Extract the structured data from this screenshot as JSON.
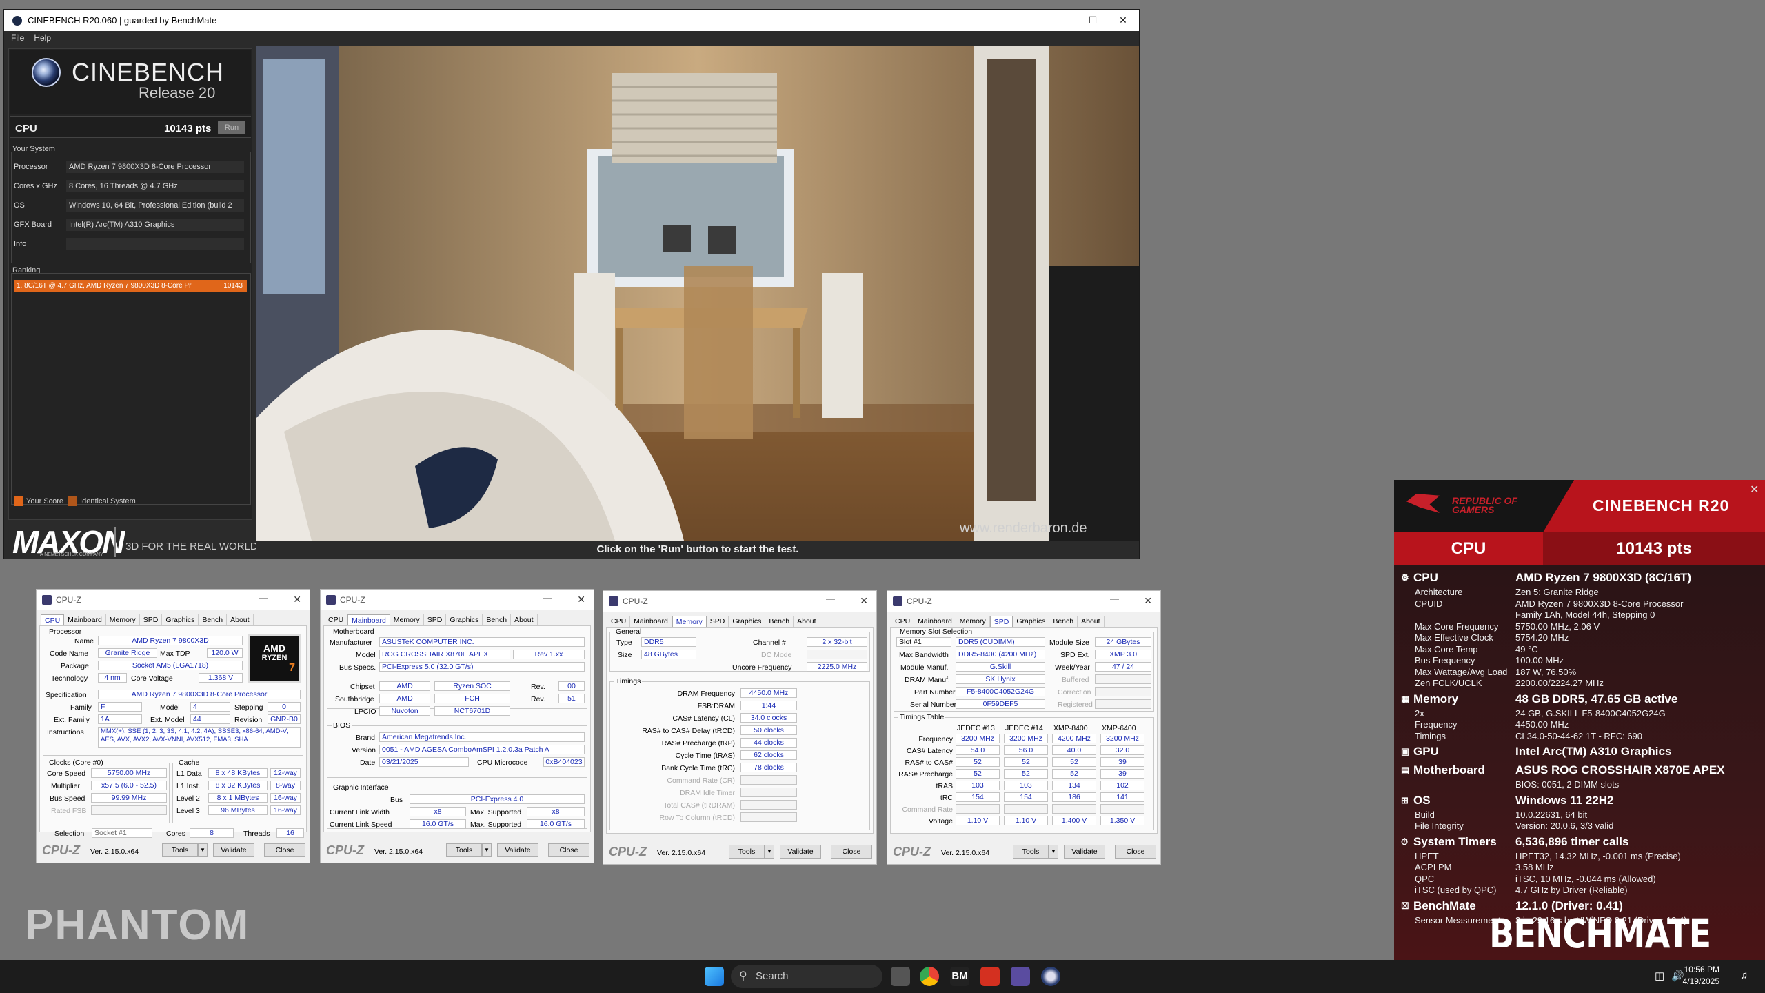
{
  "cinebench": {
    "window_title": "CINEBENCH R20.060 | guarded by BenchMate",
    "menu": [
      "File",
      "Help"
    ],
    "logo_title": "CINEBENCH",
    "logo_release": "Release 20",
    "cpu_label": "CPU",
    "cpu_score": "10143 pts",
    "run_button": "Run",
    "your_system_title": "Your System",
    "system": [
      {
        "key": "Processor",
        "value": "AMD Ryzen 7 9800X3D 8-Core Processor"
      },
      {
        "key": "Cores x GHz",
        "value": "8 Cores, 16 Threads @ 4.7 GHz"
      },
      {
        "key": "OS",
        "value": "Windows 10, 64 Bit, Professional Edition (build 2"
      },
      {
        "key": "GFX Board",
        "value": "Intel(R) Arc(TM) A310 Graphics"
      },
      {
        "key": "Info",
        "value": ""
      }
    ],
    "ranking_title": "Ranking",
    "ranking_entry": "1. 8C/16T @ 4.7 GHz, AMD Ryzen 7 9800X3D 8-Core Pr",
    "ranking_score": "10143",
    "legend_your_score": "Your Score",
    "legend_identical": "Identical System",
    "maxon_logo": "MAXON",
    "maxon_sub": "A NEMETSCHEK COMPANY",
    "maxon_tagline": "3D FOR THE REAL WORLD",
    "render_watermark": "www.renderbaron.de",
    "status_text": "Click on the 'Run' button to start the test."
  },
  "cpuz_common": {
    "title": "CPU-Z",
    "tabs": [
      "CPU",
      "Mainboard",
      "Memory",
      "SPD",
      "Graphics",
      "Bench",
      "About"
    ],
    "brand": "CPU-Z",
    "version": "Ver. 2.15.0.x64",
    "tools": "Tools",
    "validate": "Validate",
    "close": "Close"
  },
  "cpuz_cpu": {
    "group_processor": "Processor",
    "name_label": "Name",
    "name": "AMD Ryzen 7 9800X3D",
    "codename_label": "Code Name",
    "codename": "Granite Ridge",
    "maxtdp_label": "Max TDP",
    "maxtdp": "120.0 W",
    "package_label": "Package",
    "package": "Socket AM5 (LGA1718)",
    "technology_label": "Technology",
    "technology": "4 nm",
    "corevoltage_label": "Core Voltage",
    "corevoltage": "1.368 V",
    "spec_label": "Specification",
    "spec": "AMD Ryzen 7 9800X3D 8-Core Processor",
    "family_label": "Family",
    "family": "F",
    "model_label": "Model",
    "model": "4",
    "stepping_label": "Stepping",
    "stepping": "0",
    "extfamily_label": "Ext. Family",
    "extfamily": "1A",
    "extmodel_label": "Ext. Model",
    "extmodel": "44",
    "revision_label": "Revision",
    "revision": "GNR-B0",
    "instructions_label": "Instructions",
    "instructions": "MMX(+), SSE (1, 2, 3, 3S, 4.1, 4.2, 4A), SSSE3, x86-64, AMD-V, AES, AVX, AVX2, AVX-VNNI, AVX512, FMA3, SHA",
    "amd_badge_line1": "AMD",
    "amd_badge_line2": "RYZEN",
    "amd_badge_line3": "7",
    "group_clocks": "Clocks (Core #0)",
    "corespeed_label": "Core Speed",
    "corespeed": "5750.00 MHz",
    "multiplier_label": "Multiplier",
    "multiplier": "x57.5 (6.0 - 52.5)",
    "busspeed_label": "Bus Speed",
    "busspeed": "99.99 MHz",
    "ratedfsb_label": "Rated FSB",
    "group_cache": "Cache",
    "l1data_label": "L1 Data",
    "l1data": "8 x 48 KBytes",
    "l1data_way": "12-way",
    "l1inst_label": "L1 Inst.",
    "l1inst": "8 x 32 KBytes",
    "l1inst_way": "8-way",
    "l2_label": "Level 2",
    "l2": "8 x 1 MBytes",
    "l2_way": "16-way",
    "l3_label": "Level 3",
    "l3": "96 MBytes",
    "l3_way": "16-way",
    "selection_label": "Selection",
    "selection": "Socket #1",
    "cores_label": "Cores",
    "cores": "8",
    "threads_label": "Threads",
    "threads": "16"
  },
  "cpuz_mb": {
    "group_mb": "Motherboard",
    "manufacturer_label": "Manufacturer",
    "manufacturer": "ASUSTeK COMPUTER INC.",
    "model_label": "Model",
    "model": "ROG CROSSHAIR X870E APEX",
    "model_rev": "Rev 1.xx",
    "busspecs_label": "Bus Specs.",
    "busspecs": "PCI-Express 5.0 (32.0 GT/s)",
    "chipset_label": "Chipset",
    "chipset": "AMD",
    "chipset2": "Ryzen SOC",
    "rev_label": "Rev.",
    "chipset_rev": "00",
    "southbridge_label": "Southbridge",
    "southbridge": "AMD",
    "southbridge2": "FCH",
    "southbridge_rev": "51",
    "lpcio_label": "LPCIO",
    "lpcio": "Nuvoton",
    "lpcio2": "NCT6701D",
    "group_bios": "BIOS",
    "brand_label": "Brand",
    "brand": "American Megatrends Inc.",
    "version_label": "Version",
    "version": "0051 - AMD AGESA ComboAmSPI 1.2.0.3a Patch A",
    "date_label": "Date",
    "date": "03/21/2025",
    "microcode_label": "CPU Microcode",
    "microcode": "0xB404023",
    "group_gi": "Graphic Interface",
    "bus_label": "Bus",
    "bus": "PCI-Express 4.0",
    "linkwidth_label": "Current Link Width",
    "linkwidth": "x8",
    "maxsup_label": "Max. Supported",
    "maxsup_width": "x8",
    "linkspeed_label": "Current Link Speed",
    "linkspeed": "16.0 GT/s",
    "maxsup_speed": "16.0 GT/s"
  },
  "cpuz_mem": {
    "group_general": "General",
    "type_label": "Type",
    "type": "DDR5",
    "channel_label": "Channel #",
    "channel": "2 x 32-bit",
    "dcmode_label": "DC Mode",
    "size_label": "Size",
    "size": "48 GBytes",
    "uncore_label": "Uncore Frequency",
    "uncore": "2225.0 MHz",
    "group_timings": "Timings",
    "timings": [
      {
        "label": "DRAM Frequency",
        "value": "4450.0 MHz"
      },
      {
        "label": "FSB:DRAM",
        "value": "1:44"
      },
      {
        "label": "CAS# Latency (CL)",
        "value": "34.0 clocks"
      },
      {
        "label": "RAS# to CAS# Delay (tRCD)",
        "value": "50 clocks"
      },
      {
        "label": "RAS# Precharge (tRP)",
        "value": "44 clocks"
      },
      {
        "label": "Cycle Time (tRAS)",
        "value": "62 clocks"
      },
      {
        "label": "Bank Cycle Time (tRC)",
        "value": "78 clocks"
      },
      {
        "label": "Command Rate (CR)",
        "value": ""
      },
      {
        "label": "DRAM Idle Timer",
        "value": ""
      },
      {
        "label": "Total CAS# (tRDRAM)",
        "value": ""
      },
      {
        "label": "Row To Column (tRCD)",
        "value": ""
      }
    ]
  },
  "cpuz_spd": {
    "group_slot": "Memory Slot Selection",
    "slot": "Slot #1",
    "slot_type": "DDR5 (CUDIMM)",
    "modsize_label": "Module Size",
    "modsize": "24 GBytes",
    "maxbw_label": "Max Bandwidth",
    "maxbw": "DDR5-8400 (4200 MHz)",
    "spdext_label": "SPD Ext.",
    "spdext": "XMP 3.0",
    "modmanuf_label": "Module Manuf.",
    "modmanuf": "G.Skill",
    "weekyear_label": "Week/Year",
    "weekyear": "47 / 24",
    "drammanuf_label": "DRAM Manuf.",
    "drammanuf": "SK Hynix",
    "buffered_label": "Buffered",
    "partnum_label": "Part Number",
    "partnum": "F5-8400C4052G24G",
    "correction_label": "Correction",
    "serial_label": "Serial Number",
    "serial": "0F59DEF5",
    "registered_label": "Registered",
    "group_timings": "Timings Table",
    "cols": [
      "JEDEC #13",
      "JEDEC #14",
      "XMP-8400",
      "XMP-6400"
    ],
    "rows": [
      {
        "label": "Frequency",
        "vals": [
          "3200 MHz",
          "3200 MHz",
          "4200 MHz",
          "3200 MHz"
        ]
      },
      {
        "label": "CAS# Latency",
        "vals": [
          "54.0",
          "56.0",
          "40.0",
          "32.0"
        ]
      },
      {
        "label": "RAS# to CAS#",
        "vals": [
          "52",
          "52",
          "52",
          "39"
        ]
      },
      {
        "label": "RAS# Precharge",
        "vals": [
          "52",
          "52",
          "52",
          "39"
        ]
      },
      {
        "label": "tRAS",
        "vals": [
          "103",
          "103",
          "134",
          "102"
        ]
      },
      {
        "label": "tRC",
        "vals": [
          "154",
          "154",
          "186",
          "141"
        ]
      },
      {
        "label": "Command Rate",
        "vals": [
          "",
          "",
          "",
          ""
        ]
      },
      {
        "label": "Voltage",
        "vals": [
          "1.10 V",
          "1.10 V",
          "1.400 V",
          "1.350 V"
        ]
      }
    ]
  },
  "benchmate": {
    "rog_text": "REPUBLIC OF GAMERS",
    "title": "CINEBENCH R20",
    "cpu_label": "CPU",
    "score": "10143 pts",
    "sections": [
      {
        "head": "CPU",
        "head_value": "AMD Ryzen 7 9800X3D (8C/16T)",
        "rows": [
          {
            "k": "Architecture",
            "v": "Zen 5: Granite Ridge"
          },
          {
            "k": "CPUID",
            "v": "AMD Ryzen 7 9800X3D 8-Core Processor"
          },
          {
            "k": "",
            "v": "Family 1Ah, Model 44h, Stepping 0"
          },
          {
            "k": "Max Core Frequency",
            "v": "5750.00 MHz, 2.06 V"
          },
          {
            "k": "Max Effective Clock",
            "v": "5754.20 MHz"
          },
          {
            "k": "Max Core Temp",
            "v": "49 °C"
          },
          {
            "k": "Bus Frequency",
            "v": "100.00 MHz"
          },
          {
            "k": "Max Wattage/Avg Load",
            "v": "187 W, 76.50%"
          },
          {
            "k": "Zen FCLK/UCLK",
            "v": "2200.00/2224.27 MHz"
          }
        ]
      },
      {
        "head": "Memory",
        "head_value": "48 GB DDR5, 47.65 GB active",
        "rows": [
          {
            "k": "2x",
            "v": "24 GB, G.SKILL F5-8400C4052G24G"
          },
          {
            "k": "Frequency",
            "v": "4450.00 MHz"
          },
          {
            "k": "Timings",
            "v": "CL34.0-50-44-62 1T - RFC: 690"
          }
        ]
      },
      {
        "head": "GPU",
        "head_value": "Intel Arc(TM) A310 Graphics",
        "rows": []
      },
      {
        "head": "Motherboard",
        "head_value": "ASUS ROG CROSSHAIR X870E APEX",
        "rows": [
          {
            "k": "",
            "v": "BIOS: 0051, 2 DIMM slots"
          }
        ]
      },
      {
        "head": "OS",
        "head_value": "Windows 11 22H2",
        "rows": [
          {
            "k": "Build",
            "v": "10.0.22631, 64 bit"
          },
          {
            "k": "File Integrity",
            "v": "Version: 20.0.6, 3/3 valid"
          }
        ]
      },
      {
        "head": "System Timers",
        "head_value": "6,536,896 timer calls",
        "rows": [
          {
            "k": "HPET",
            "v": "HPET32, 14.32 MHz, -0.001 ms (Precise)"
          },
          {
            "k": "ACPI PM",
            "v": "3.58 MHz"
          },
          {
            "k": "QPC",
            "v": "iTSC, 10 MHz, -0.044 ms (Allowed)"
          },
          {
            "k": "iTSC (used by QPC)",
            "v": "4.7 GHz by Driver (Reliable)"
          }
        ]
      },
      {
        "head": "BenchMate",
        "head_value": "12.1.0 (Driver: 0.41)",
        "rows": [
          {
            "k": "Sensor Measurements",
            "v": "3 in 29.16 s by HWiNFO 8.21 (Driver: 12.4)"
          }
        ]
      }
    ],
    "logo": "BENCHMATE"
  },
  "wallpaper_text": "PHANTOM",
  "taskbar": {
    "search_placeholder": "Search",
    "time": "10:56 PM",
    "date": "4/19/2025"
  },
  "colors": {
    "accent_orange": "#e0661a",
    "bm_red": "#b8141c",
    "cpuz_value": "#1a2bb5"
  }
}
